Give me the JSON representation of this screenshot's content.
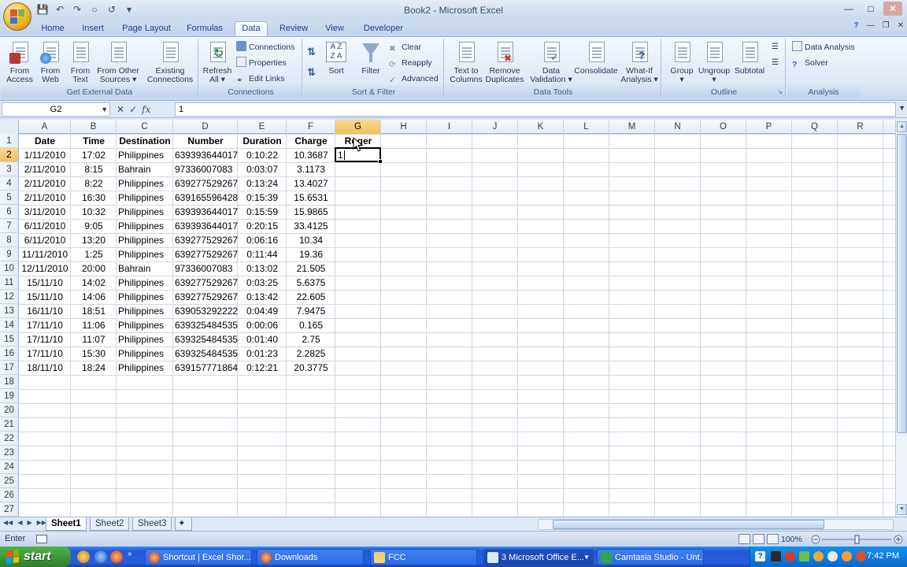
{
  "window": {
    "title": "Book2 - Microsoft Excel"
  },
  "ribbon_tabs": [
    "Home",
    "Insert",
    "Page Layout",
    "Formulas",
    "Data",
    "Review",
    "View",
    "Developer"
  ],
  "active_tab": "Data",
  "ribbon": {
    "get_external": {
      "label": "Get External Data",
      "buttons": [
        {
          "line1": "From",
          "line2": "Access"
        },
        {
          "line1": "From",
          "line2": "Web"
        },
        {
          "line1": "From",
          "line2": "Text"
        },
        {
          "line1": "From Other",
          "line2": "Sources"
        },
        {
          "line1": "Existing",
          "line2": "Connections"
        }
      ]
    },
    "connections": {
      "label": "Connections",
      "refresh": {
        "line1": "Refresh",
        "line2": "All"
      },
      "items": [
        "Connections",
        "Properties",
        "Edit Links"
      ]
    },
    "sort_filter": {
      "label": "Sort & Filter",
      "sort": "Sort",
      "filter": "Filter",
      "items": [
        "Clear",
        "Reapply",
        "Advanced"
      ]
    },
    "data_tools": {
      "label": "Data Tools",
      "buttons": [
        {
          "line1": "Text to",
          "line2": "Columns"
        },
        {
          "line1": "Remove",
          "line2": "Duplicates"
        },
        {
          "line1": "Data",
          "line2": "Validation"
        },
        {
          "line1": "Consolidate",
          "line2": ""
        },
        {
          "line1": "What-If",
          "line2": "Analysis"
        }
      ]
    },
    "outline": {
      "label": "Outline",
      "buttons": [
        "Group",
        "Ungroup",
        "Subtotal"
      ]
    },
    "analysis": {
      "label": "Analysis",
      "items": [
        "Data Analysis",
        "Solver"
      ]
    }
  },
  "formula_bar": {
    "name_box": "G2",
    "value": "1"
  },
  "columns": [
    "A",
    "B",
    "C",
    "D",
    "E",
    "F",
    "G",
    "H",
    "I",
    "J",
    "K",
    "L",
    "M",
    "N",
    "O",
    "P",
    "Q",
    "R"
  ],
  "rows": [
    "1",
    "2",
    "3",
    "4",
    "5",
    "6",
    "7",
    "8",
    "9",
    "10",
    "11",
    "12",
    "13",
    "14",
    "15",
    "16",
    "17",
    "18",
    "19",
    "20",
    "21",
    "22",
    "23",
    "24",
    "25",
    "26",
    "27"
  ],
  "headers": [
    "Date",
    "Time",
    "Destination",
    "Number",
    "Duration",
    "Charge",
    "Roger"
  ],
  "table": [
    [
      "1/11/2010",
      "17:02",
      "Philippines",
      "639393644017",
      "0:10:22",
      "10.3687"
    ],
    [
      "2/11/2010",
      "8:15",
      "Bahrain",
      "97336007083",
      "0:03:07",
      "3.1173"
    ],
    [
      "2/11/2010",
      "8:22",
      "Philippines",
      "639277529267",
      "0:13:24",
      "13.4027"
    ],
    [
      "2/11/2010",
      "16:30",
      "Philippines",
      "639165596428",
      "0:15:39",
      "15.6531"
    ],
    [
      "3/11/2010",
      "10:32",
      "Philippines",
      "639393644017",
      "0:15:59",
      "15.9865"
    ],
    [
      "6/11/2010",
      "9:05",
      "Philippines",
      "639393644017",
      "0:20:15",
      "33.4125"
    ],
    [
      "6/11/2010",
      "13:20",
      "Philippines",
      "639277529267",
      "0:06:16",
      "10.34"
    ],
    [
      "11/11/2010",
      "1:25",
      "Philippines",
      "639277529267",
      "0:11:44",
      "19.36"
    ],
    [
      "12/11/2010",
      "20:00",
      "Bahrain",
      "97336007083",
      "0:13:02",
      "21.505"
    ],
    [
      "15/11/10",
      "14:02",
      "Philippines",
      "639277529267",
      "0:03:25",
      "5.6375"
    ],
    [
      "15/11/10",
      "14:06",
      "Philippines",
      "639277529267",
      "0:13:42",
      "22.605"
    ],
    [
      "16/11/10",
      "18:51",
      "Philippines",
      "639053292222",
      "0:04:49",
      "7.9475"
    ],
    [
      "17/11/10",
      "11:06",
      "Philippines",
      "639325484535",
      "0:00:06",
      "0.165"
    ],
    [
      "17/11/10",
      "11:07",
      "Philippines",
      "639325484535",
      "0:01:40",
      "2.75"
    ],
    [
      "17/11/10",
      "15:30",
      "Philippines",
      "639325484535",
      "0:01:23",
      "2.2825"
    ],
    [
      "18/11/10",
      "18:24",
      "Philippines",
      "639157771864",
      "0:12:21",
      "20.3775"
    ]
  ],
  "editing_value": "1",
  "sheets": [
    "Sheet1",
    "Sheet2",
    "Sheet3"
  ],
  "active_sheet": "Sheet1",
  "status": {
    "mode": "Enter",
    "zoom": "100%"
  },
  "taskbar": {
    "start": "start",
    "tasks": [
      "Shortcut | Excel Shor...",
      "Downloads",
      "FCC",
      "3 Microsoft Office E...",
      "Camtasia Studio - Unt..."
    ],
    "clock": "7:42 PM"
  }
}
